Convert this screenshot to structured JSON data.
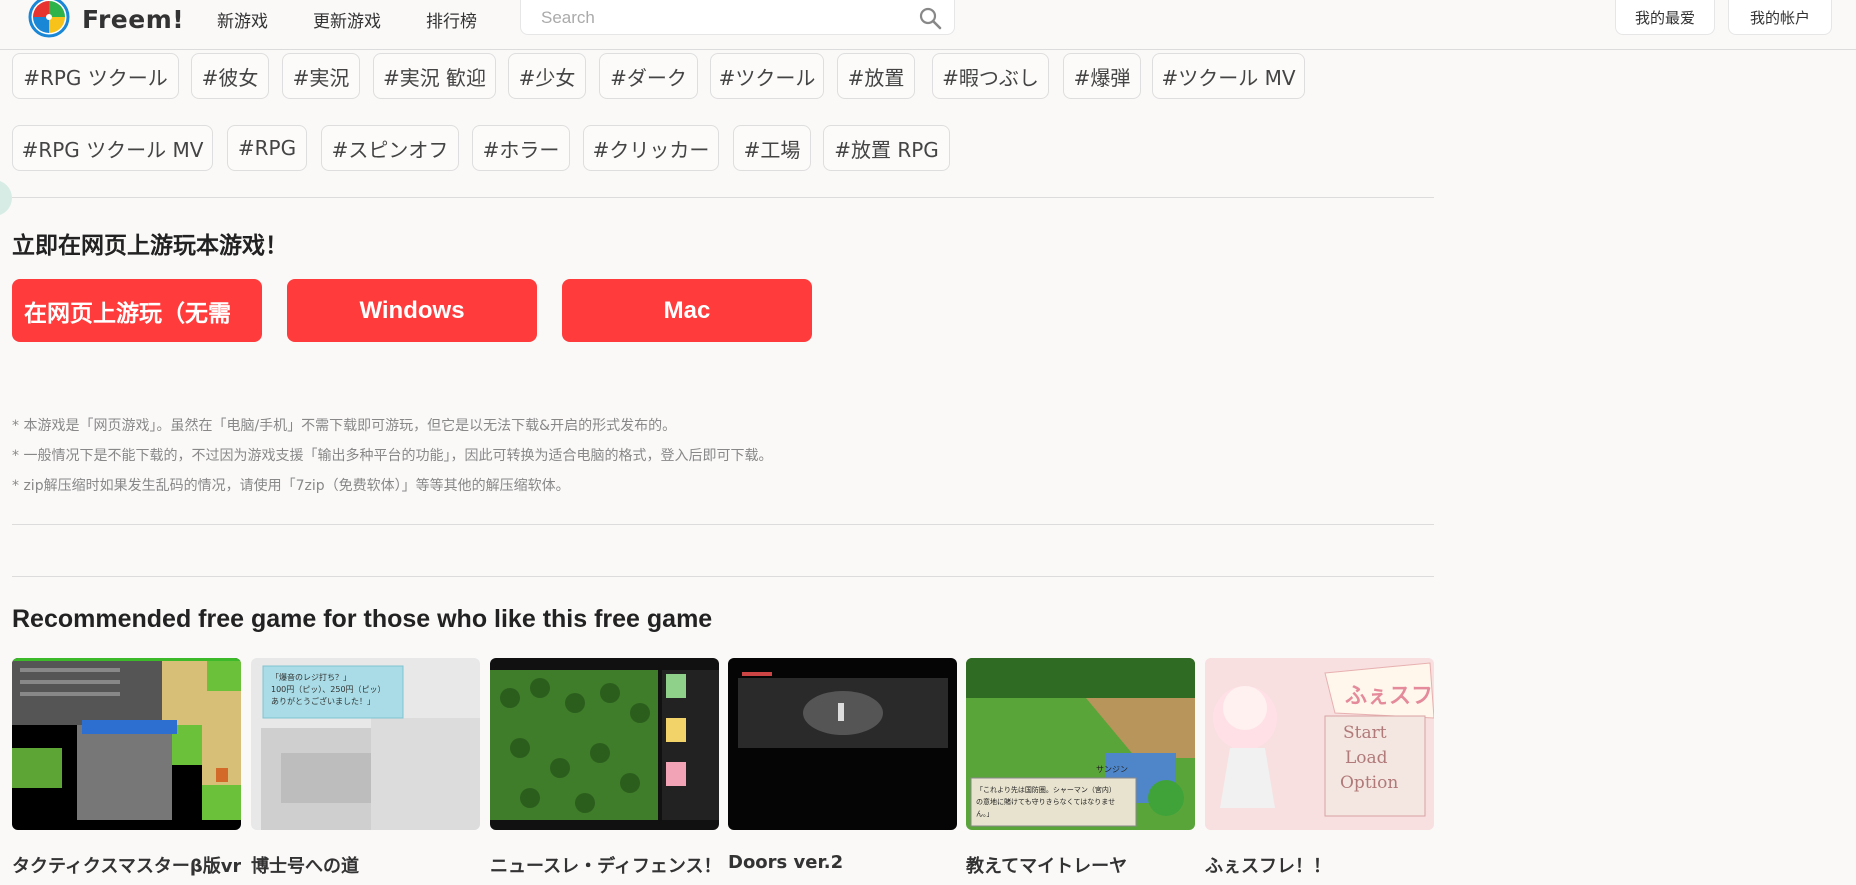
{
  "header": {
    "logo_text": "Freem!",
    "nav": [
      "新游戏",
      "更新游戏",
      "排行榜"
    ],
    "search_placeholder": "Search",
    "favorites_label": "我的最爱",
    "account_label": "我的帐户"
  },
  "tags_row1": [
    "#RPG ツクール",
    "#彼女",
    "#実況",
    "#実況 歓迎",
    "#少女",
    "#ダーク",
    "#ツクール",
    "#放置",
    "#暇つぶし",
    "#爆弾",
    "#ツクール MV"
  ],
  "tags_row2": [
    "#RPG ツクール MV",
    "#RPG",
    "#スピンオフ",
    "#ホラー",
    "#クリッカー",
    "#工場",
    "#放置 RPG"
  ],
  "play": {
    "title": "立即在网页上游玩本游戏！",
    "buttons": [
      "在网页上游玩（无需",
      "Windows",
      "Mac"
    ]
  },
  "notes": [
    "* 本游戏是「网页游戏」。虽然在「电脑/手机」不需下载即可游玩，但它是以无法下载&开启的形式发布的。",
    "* 一般情况下是不能下载的，不过因为游戏支援「输出多种平台的功能」，因此可转换为适合电脑的格式，登入后即可下载。",
    "* zip解压缩时如果发生乱码的情况，请使用「7zip（免费软体）」等等其他的解压缩软体。"
  ],
  "recommended": {
    "title": "Recommended free game for those who like this free game",
    "games": [
      {
        "name": "タクティクスマスターβ版vr",
        "thumb": "tactics-grid-screenshot"
      },
      {
        "name": "博士号への道",
        "thumb": "cash-register-screenshot"
      },
      {
        "name": "ニュースレ・ディフェンス！",
        "thumb": "forest-battle-screenshot"
      },
      {
        "name": "Doors ver.2",
        "thumb": "dark-corridor-screenshot"
      },
      {
        "name": "教えてマイトレーヤ",
        "thumb": "field-dialogue-screenshot"
      },
      {
        "name": "ふぇスフレ！！",
        "thumb": "anime-girl-title-screenshot"
      }
    ],
    "thumb_texts": {
      "register_line1": "「爆音のレジ打ち？」",
      "register_line2": "100円（ピッ）、250円（ピッ）",
      "register_line3": "ありがとうございました！」",
      "field_speaker": "サンジン",
      "field_line1": "「これより先は国防圏。シャーマン（宮内）",
      "field_line2": "の意地に賭けても守りきらなくてはなりませ",
      "field_line3": "ん。」",
      "title_logo": "ふぇスフレ！",
      "menu_start": "Start",
      "menu_load": "Load",
      "menu_option": "Option"
    }
  },
  "colors": {
    "accent_red": "#ff3b3b",
    "background": "#faf9f8"
  }
}
